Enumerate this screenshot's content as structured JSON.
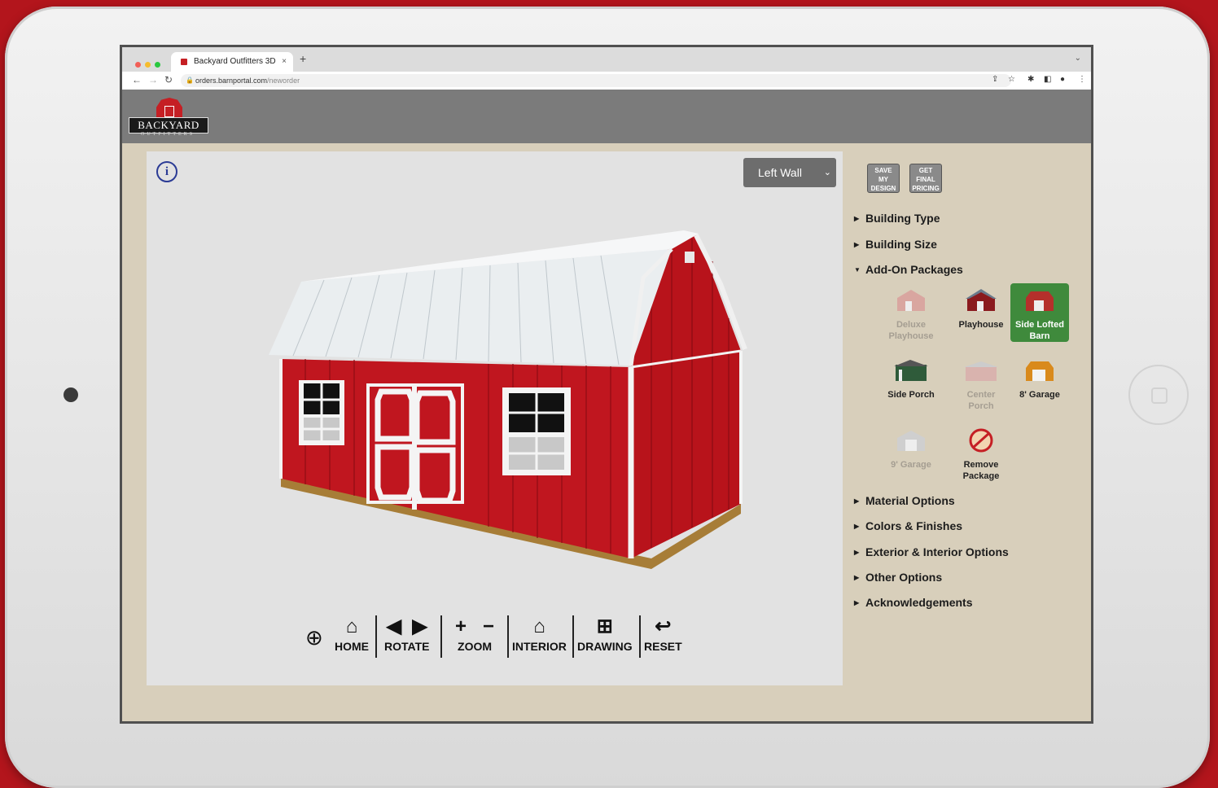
{
  "browser": {
    "tab_title": "Backyard Outfitters 3D",
    "tab_close": "×",
    "new_tab": "+",
    "url_host": "orders.barnportal.com",
    "url_path": "/neworder",
    "traffic_colors": [
      "#f25f57",
      "#f6bc2e",
      "#2ac840"
    ]
  },
  "app": {
    "logo_text": "BACKYARD",
    "logo_sub": "OUTFITTERS",
    "brand_color": "#c51f24"
  },
  "viewer": {
    "info_icon": "i",
    "view_select": "Left Wall",
    "toolbar": {
      "home": "HOME",
      "rotate": "ROTATE",
      "zoom": "ZOOM",
      "interior": "INTERIOR",
      "drawing": "DRAWING",
      "reset": "RESET"
    }
  },
  "sidebar": {
    "save_button": [
      "SAVE",
      "MY",
      "DESIGN"
    ],
    "pricing_button": [
      "GET",
      "FINAL",
      "PRICING"
    ],
    "sections": {
      "building_type": "Building Type",
      "building_size": "Building Size",
      "add_on_packages": "Add-On Packages",
      "material_options": "Material Options",
      "colors_finishes": "Colors & Finishes",
      "exterior_interior": "Exterior & Interior Options",
      "other_options": "Other Options",
      "acknowledgements": "Acknowledgements"
    },
    "packages": {
      "deluxe_playhouse": [
        "Deluxe",
        "Playhouse"
      ],
      "playhouse": [
        "Playhouse"
      ],
      "side_lofted_barn": [
        "Side Lofted",
        "Barn"
      ],
      "side_porch": [
        "Side Porch"
      ],
      "center_porch": [
        "Center",
        "Porch"
      ],
      "garage_8": [
        "8' Garage"
      ],
      "garage_9": [
        "9' Garage"
      ],
      "remove_package": [
        "Remove",
        "Package"
      ]
    },
    "selected_package": "Side Lofted Barn"
  }
}
